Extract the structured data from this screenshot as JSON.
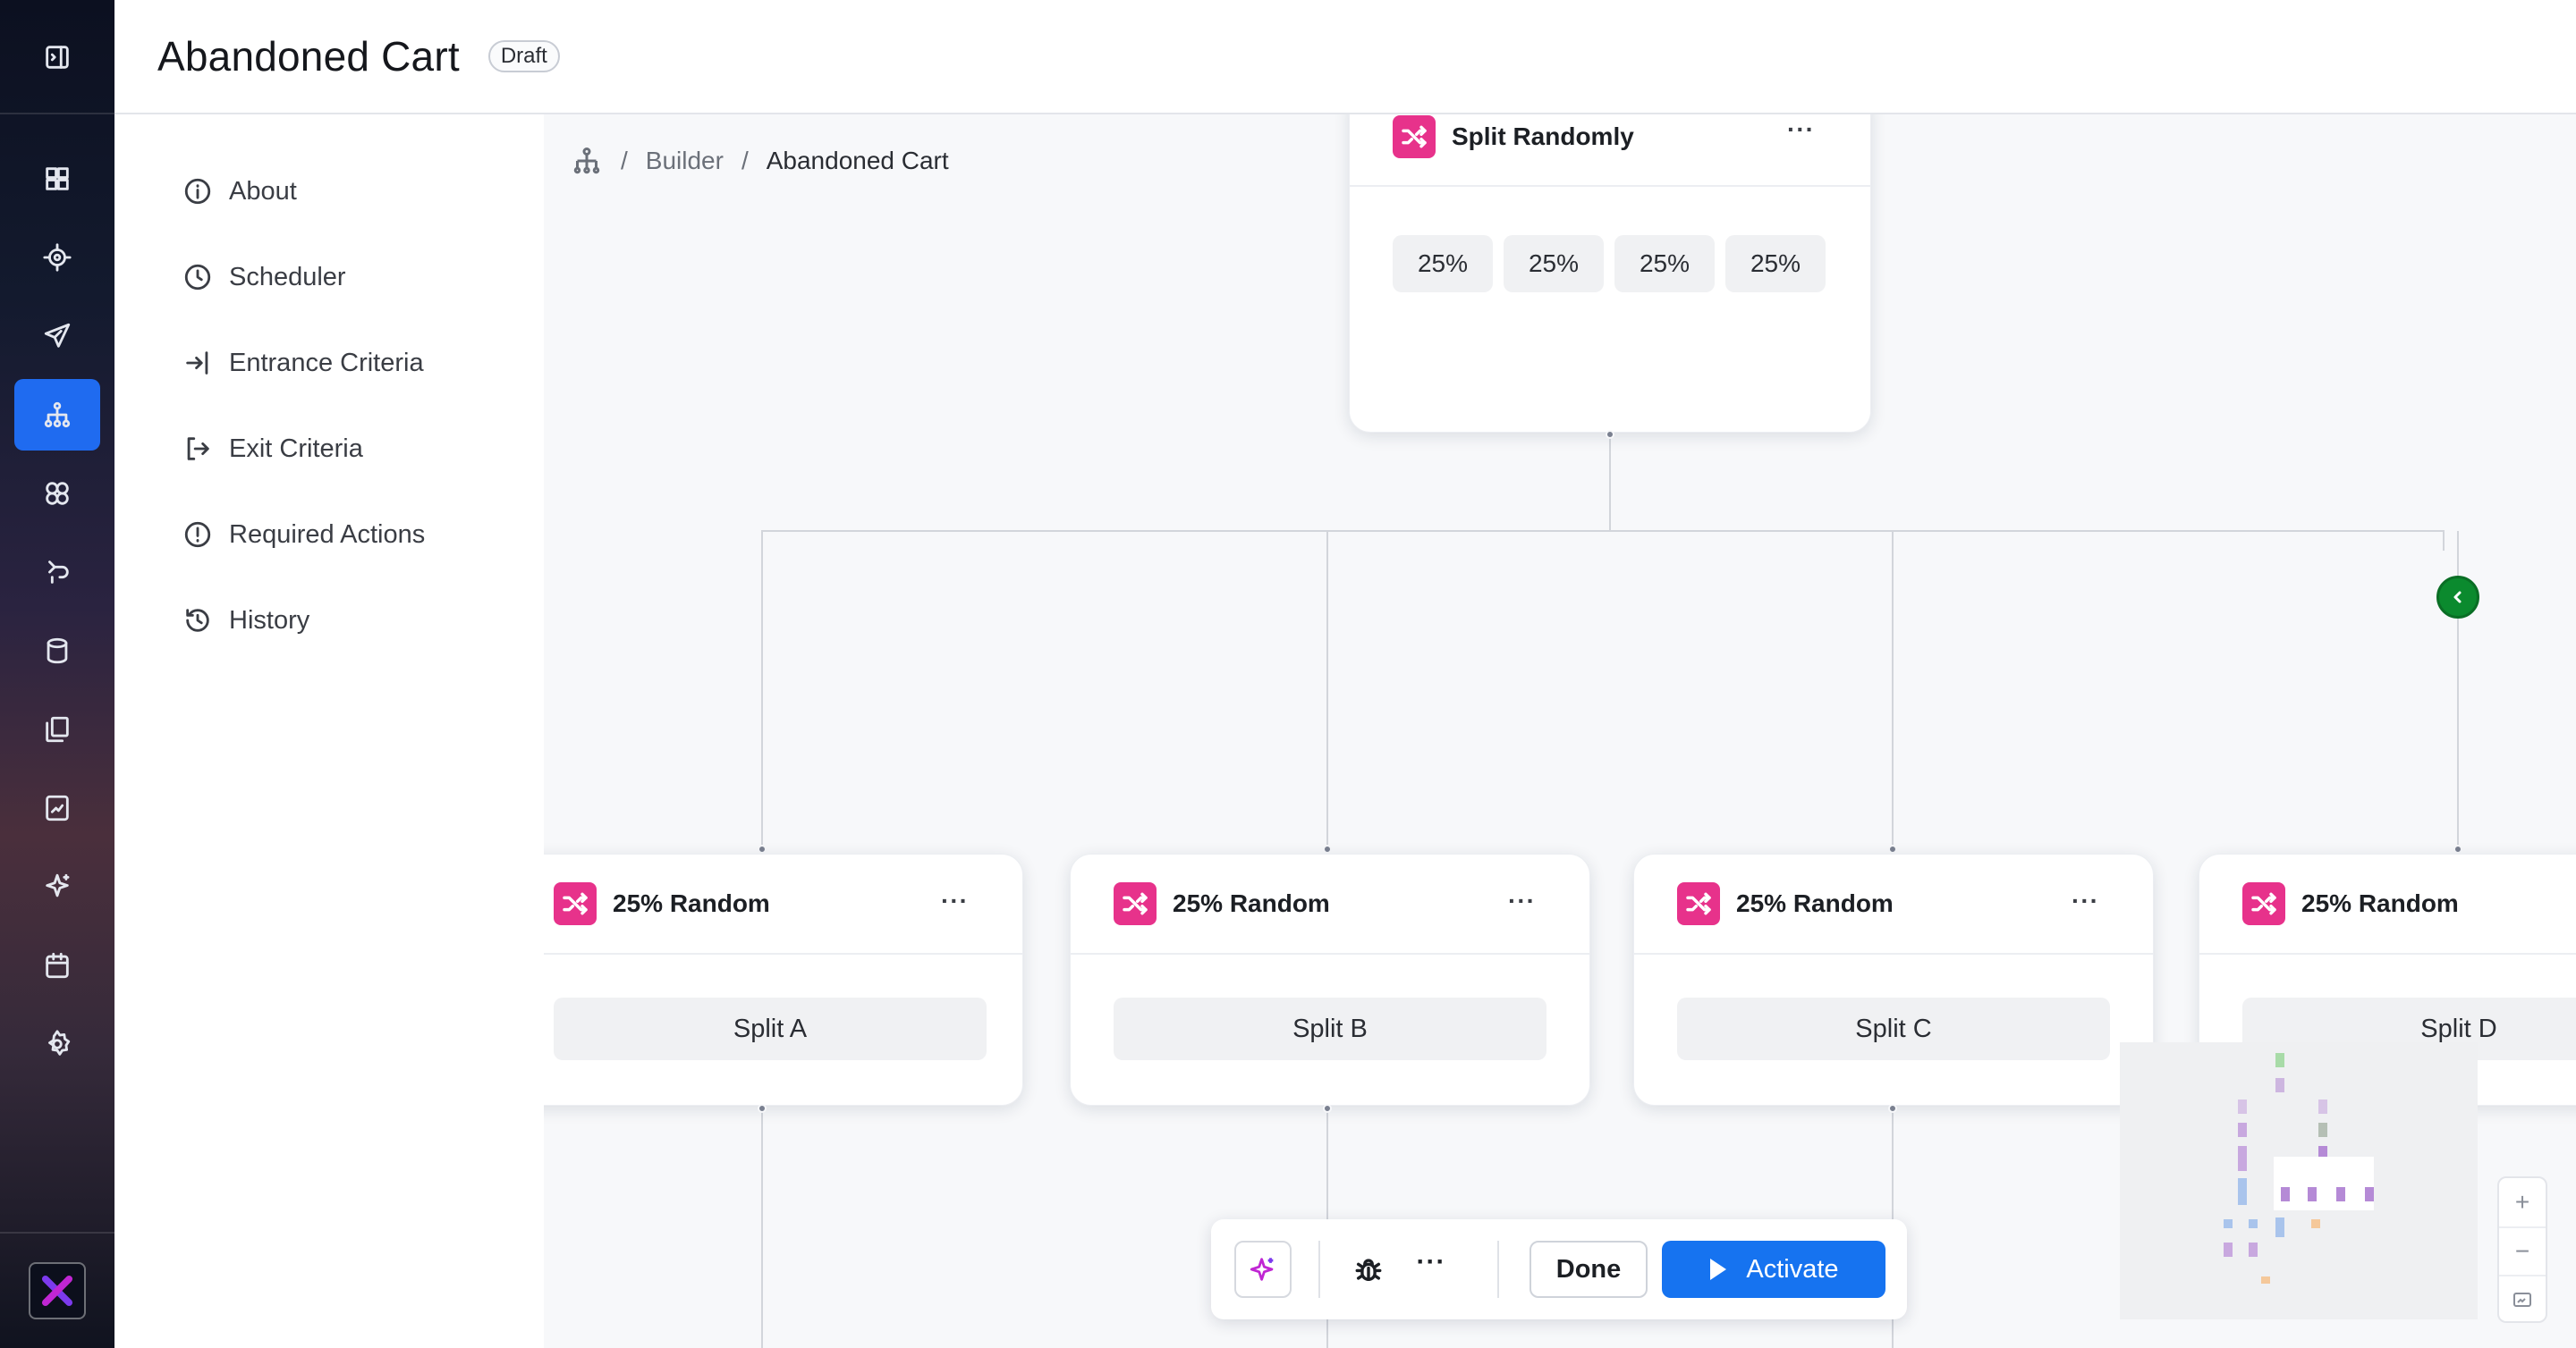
{
  "header": {
    "title": "Abandoned Cart",
    "status_badge": "Draft"
  },
  "rail": {
    "items": [
      {
        "icon": "panel-toggle-icon"
      },
      {
        "icon": "dashboard-icon"
      },
      {
        "icon": "target-icon"
      },
      {
        "icon": "send-icon"
      },
      {
        "icon": "journey-builder-icon",
        "active": true
      },
      {
        "icon": "segments-icon"
      },
      {
        "icon": "integrations-icon"
      },
      {
        "icon": "database-icon"
      },
      {
        "icon": "templates-icon"
      },
      {
        "icon": "reports-icon"
      },
      {
        "icon": "ai-sparkle-icon"
      },
      {
        "icon": "calendar-icon"
      },
      {
        "icon": "settings-gear-icon"
      }
    ],
    "accent": "#1f6bf0"
  },
  "menu": {
    "items": [
      {
        "label": "About",
        "icon": "info-icon"
      },
      {
        "label": "Scheduler",
        "icon": "clock-icon"
      },
      {
        "label": "Entrance Criteria",
        "icon": "enter-icon"
      },
      {
        "label": "Exit Criteria",
        "icon": "exit-icon"
      },
      {
        "label": "Required Actions",
        "icon": "alert-circle-icon"
      },
      {
        "label": "History",
        "icon": "history-icon"
      }
    ]
  },
  "breadcrumb": {
    "root_icon": "hierarchy-icon",
    "sep": "/",
    "builder": "Builder",
    "current": "Abandoned Cart"
  },
  "canvas": {
    "root_node": {
      "title": "Split Randomly",
      "more": "···",
      "percentages": [
        "25%",
        "25%",
        "25%",
        "25%"
      ]
    },
    "branch_nodes": [
      {
        "title": "25% Random",
        "more": "···",
        "split": "Split A"
      },
      {
        "title": "25% Random",
        "more": "···",
        "split": "Split B"
      },
      {
        "title": "25% Random",
        "more": "···",
        "split": "Split C"
      },
      {
        "title": "25% Random",
        "more": "···",
        "split": "Split D"
      }
    ],
    "node_color": "#e7328b",
    "collapse_color": "#0b8a2e"
  },
  "toolbar": {
    "more": "···",
    "done": "Done",
    "activate": "Activate",
    "activate_color": "#1673f0"
  },
  "zoom": {
    "in": "+",
    "out": "−"
  }
}
